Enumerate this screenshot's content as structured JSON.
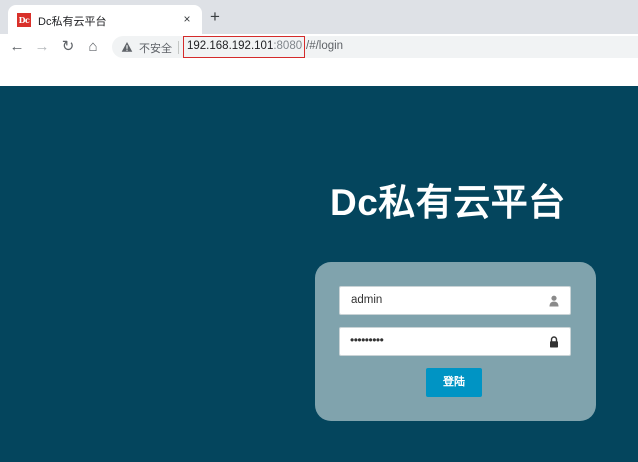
{
  "browser": {
    "tab": {
      "title": "Dc私有云平台",
      "favicon_text": "Dc",
      "close_glyph": "×"
    },
    "new_tab_glyph": "+",
    "nav": {
      "back": "←",
      "forward": "→",
      "reload": "↻",
      "home": "⌂"
    },
    "address_bar": {
      "security_label": "不安全",
      "host": "192.168.192.101",
      "port": ":8080",
      "path": "/#/login"
    }
  },
  "page": {
    "title": "Dc私有云平台",
    "login": {
      "username_value": "admin",
      "password_mask": "•••••••••",
      "submit_label": "登陆"
    }
  },
  "colors": {
    "page_background": "#04455d",
    "card_background": "#80a3ad",
    "button_accent": "#0094c4",
    "url_highlight_border": "#d42b2b"
  },
  "icons": {
    "favicon": "dc-logo-icon",
    "warning": "warning-triangle-icon",
    "username": "user-icon",
    "password": "lock-icon"
  }
}
